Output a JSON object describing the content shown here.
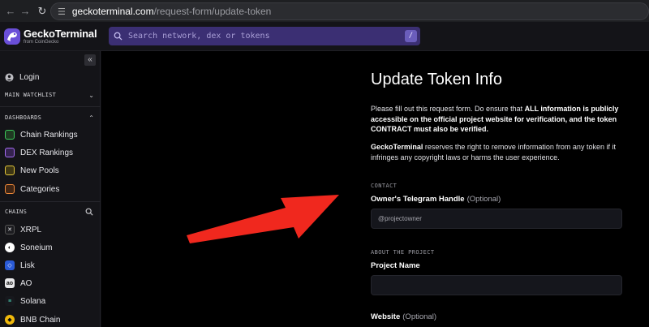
{
  "browser": {
    "url_host": "geckoterminal.com",
    "url_path": "/request-form/update-token"
  },
  "header": {
    "logo_name": "GeckoTerminal",
    "logo_sub": "from CoinGecko",
    "search_placeholder": "Search network, dex or tokens",
    "search_shortcut": "/"
  },
  "sidebar": {
    "login": "Login",
    "main_watchlist": "MAIN WATCHLIST",
    "dashboards_header": "DASHBOARDS",
    "dashboards": [
      {
        "label": "Chain Rankings",
        "icon": "chart-icon"
      },
      {
        "label": "DEX Rankings",
        "icon": "bar-chart-icon"
      },
      {
        "label": "New Pools",
        "icon": "pool-icon"
      },
      {
        "label": "Categories",
        "icon": "tag-icon"
      }
    ],
    "chains_header": "CHAINS",
    "chains": [
      {
        "label": "XRPL",
        "icon": "xrpl-icon"
      },
      {
        "label": "Soneium",
        "icon": "soneium-icon"
      },
      {
        "label": "Lisk",
        "icon": "lisk-icon"
      },
      {
        "label": "AO",
        "icon": "ao-icon"
      },
      {
        "label": "Solana",
        "icon": "solana-icon"
      },
      {
        "label": "BNB Chain",
        "icon": "bnb-icon"
      }
    ]
  },
  "form": {
    "title": "Update Token Info",
    "intro_1": "Please fill out this request form. Do ensure that ",
    "intro_bold": "ALL information is publicly accessible on the official project website for verification, and the token CONTRACT must also be verified.",
    "notice_bold": "GeckoTerminal",
    "notice_rest": " reserves the right to remove information from any token if it infringes any copyright laws or harms the user experience.",
    "contact_section": "CONTACT",
    "telegram_label": "Owner's Telegram Handle",
    "optional": "(Optional)",
    "telegram_placeholder": "@projectowner",
    "about_section": "ABOUT THE PROJECT",
    "project_name_label": "Project Name",
    "project_name_value": "",
    "website_label": "Website",
    "website_optional": "(Optional)"
  },
  "colors": {
    "accent_purple": "#3b2f73",
    "arrow_red": "#f0281e"
  }
}
